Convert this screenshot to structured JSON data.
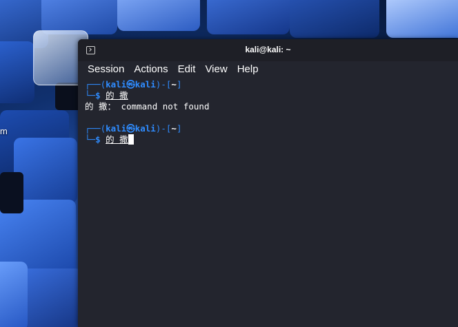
{
  "desktop": {
    "label_fragment": "m"
  },
  "window": {
    "title": "kali@kali: ~",
    "menu": [
      "Session",
      "Actions",
      "Edit",
      "View",
      "Help"
    ]
  },
  "terminal": {
    "prompt": {
      "open_frame": "┌──(",
      "user": "kali",
      "at_symbol": "㉿",
      "host": "kali",
      "mid_frame": ")-[",
      "dir": "~",
      "close_frame": "]",
      "second_frame": "└─",
      "dollar": "$"
    },
    "entries": [
      {
        "command": "的 撒",
        "output": "的 撒： command not found"
      },
      {
        "command": "的 撒",
        "output": ""
      }
    ]
  },
  "colors": {
    "prompt_blue": "#2f8cff",
    "terminal_bg": "#23252e",
    "titlebar_bg": "#1e1f26",
    "text": "#ffffff"
  }
}
